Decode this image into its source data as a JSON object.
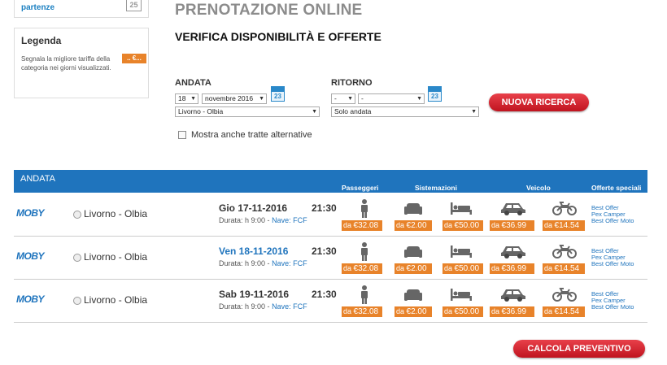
{
  "sidebar": {
    "top_label": "partenze",
    "calendar_day": "25",
    "legend_title": "Legenda",
    "legend_text": "Segnala la migliore tariffa della categoria nei giorni visualizzati.",
    "legend_badge": ".. €..."
  },
  "header": {
    "title": "PRENOTAZIONE ONLINE",
    "subtitle": "VERIFICA DISPONIBILITÀ E OFFERTE"
  },
  "form": {
    "andata_label": "ANDATA",
    "ritorno_label": "RITORNO",
    "andata_day": "18",
    "andata_month": "novembre 2016",
    "andata_route": "Livorno - Olbia",
    "ritorno_day": "-",
    "ritorno_month": "-",
    "ritorno_route": "Solo andata",
    "calendar_icon_num": "23",
    "checkbox_label": "Mostra anche tratte alternative",
    "search_button": "NUOVA RICERCA"
  },
  "results": {
    "header_title": "ANDATA",
    "col_passengers": "Passeggeri",
    "col_accommodation": "Sistemazioni",
    "col_vehicle": "Veicolo",
    "col_offers": "Offerte speciali",
    "rows": [
      {
        "logo": "MOBY",
        "route": "Livorno - Olbia",
        "day": "Gio 17-11-2016",
        "time": "21:30",
        "duration": "Durata: h 9:00 -",
        "ship": "Nave: FCF",
        "prefix": "da",
        "p_pass": "€32.08",
        "p_seat": "€2.00",
        "p_cabin": "€50.00",
        "p_car": "€36.99",
        "p_moto": "€14.54",
        "offer1": "Best Offer",
        "offer2": "Pex Camper",
        "offer3": "Best Offer Moto"
      },
      {
        "logo": "MOBY",
        "route": "Livorno - Olbia",
        "day": "Ven 18-11-2016",
        "time": "21:30",
        "duration": "Durata: h 9:00 -",
        "ship": "Nave: FCF",
        "prefix": "da",
        "p_pass": "€32.08",
        "p_seat": "€2.00",
        "p_cabin": "€50.00",
        "p_car": "€36.99",
        "p_moto": "€14.54",
        "offer1": "Best Offer",
        "offer2": "Pex Camper",
        "offer3": "Best Offer Moto"
      },
      {
        "logo": "MOBY",
        "route": "Livorno - Olbia",
        "day": "Sab 19-11-2016",
        "time": "21:30",
        "duration": "Durata: h 9:00 -",
        "ship": "Nave: FCF",
        "prefix": "da",
        "p_pass": "€32.08",
        "p_seat": "€2.00",
        "p_cabin": "€50.00",
        "p_car": "€36.99",
        "p_moto": "€14.54",
        "offer1": "Best Offer",
        "offer2": "Pex Camper",
        "offer3": "Best Offer Moto"
      }
    ]
  },
  "footer": {
    "calc_button": "CALCOLA PREVENTIVO"
  },
  "colors": {
    "brand_blue": "#1f74bd",
    "price_orange": "#e8832a",
    "button_red": "#c0141f"
  }
}
